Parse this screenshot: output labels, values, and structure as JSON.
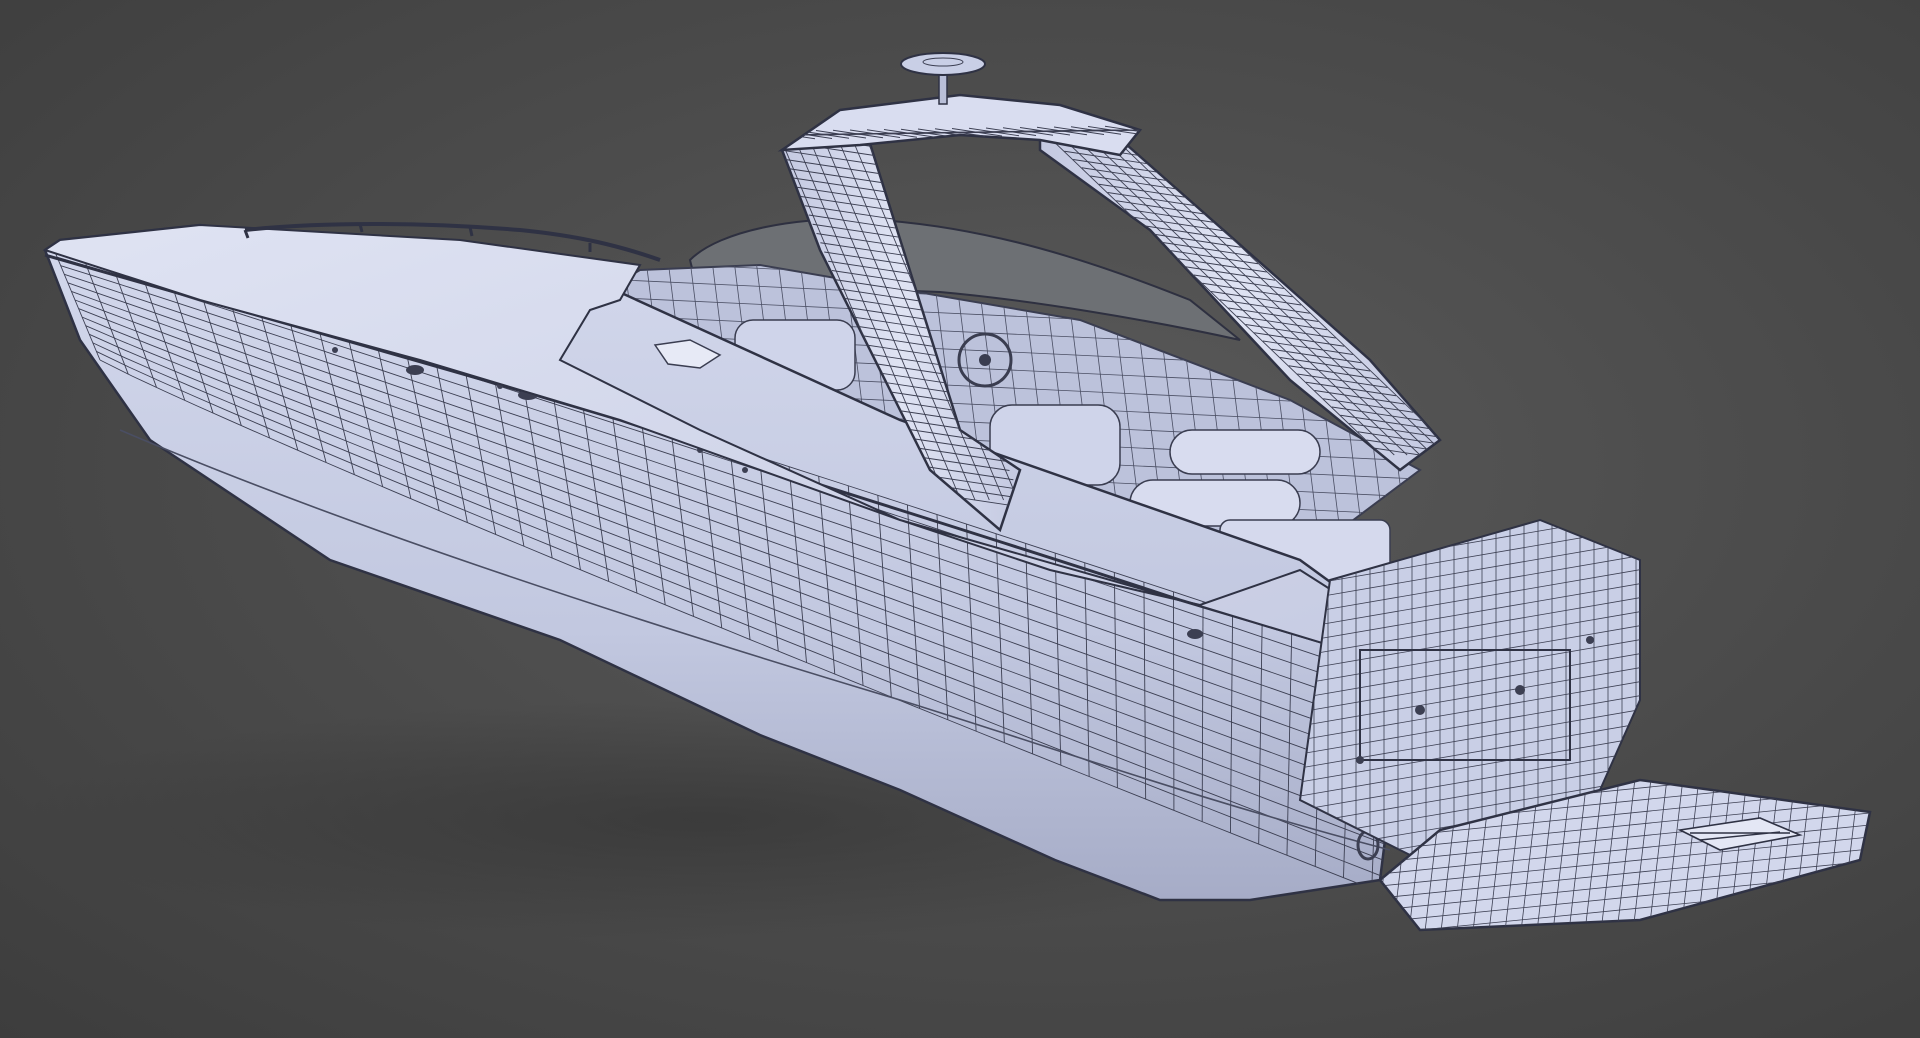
{
  "scene": {
    "subject": "speedboat-wireframe-render",
    "colors": {
      "background": "#4a4a4a",
      "hull_fill": "#c9cfe6",
      "hull_shade": "#a9b0cc",
      "deck_fill": "#d6dbee",
      "wire": "#3c3f52",
      "windshield": "#6b6e72",
      "shadow": "#333333"
    },
    "wire_density": {
      "hull_columns": 46,
      "hull_rows": 14,
      "arch_bands": 40,
      "deck_columns": 30
    }
  }
}
